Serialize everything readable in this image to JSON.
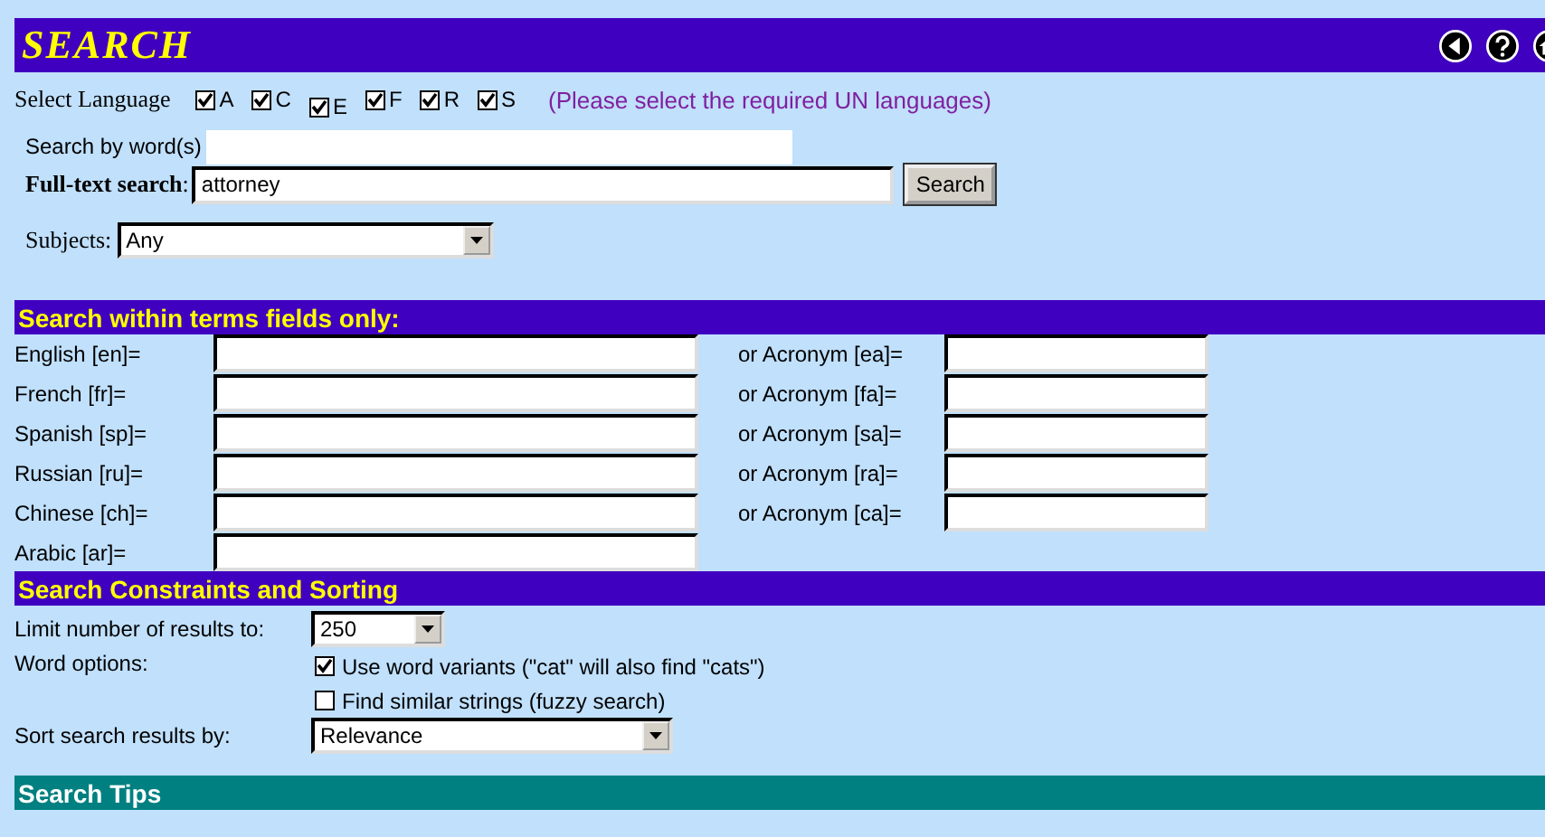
{
  "header": {
    "title": "SEARCH"
  },
  "language": {
    "label": "Select Language",
    "options": [
      {
        "label": "A",
        "checked": true
      },
      {
        "label": "C",
        "checked": true
      },
      {
        "label": "E",
        "checked": true
      },
      {
        "label": "F",
        "checked": true
      },
      {
        "label": "R",
        "checked": true
      },
      {
        "label": "S",
        "checked": true
      }
    ],
    "hint": "(Please select the required UN languages)"
  },
  "search_by_words": {
    "label": "Search by word(s)"
  },
  "full_text": {
    "label": "**Full-text search**:",
    "value": "attorney",
    "button": "Search"
  },
  "subjects": {
    "label": "Subjects:",
    "value": "Any"
  },
  "terms": {
    "title": "Search within terms fields only:",
    "rows": [
      {
        "label": "English [en]=",
        "acronym": "or Acronym [ea]="
      },
      {
        "label": "French [fr]=",
        "acronym": "or Acronym [fa]="
      },
      {
        "label": "Spanish [sp]=",
        "acronym": "or Acronym [sa]="
      },
      {
        "label": "Russian [ru]=",
        "acronym": "or Acronym [ra]="
      },
      {
        "label": "Chinese [ch]=",
        "acronym": "or Acronym [ca]="
      },
      {
        "label": "Arabic [ar]="
      }
    ]
  },
  "constraints": {
    "title": "Search Constraints and Sorting",
    "limit": {
      "label": "Limit number of results to:",
      "value": "250"
    },
    "word_options": {
      "label": "Word options:",
      "options": [
        {
          "label": "Use word variants (\"cat\" will also find \"cats\")",
          "checked": true
        },
        {
          "label": "Find similar strings (fuzzy search)",
          "checked": false
        }
      ]
    },
    "sort": {
      "label": "Sort search results by:",
      "value": "Relevance"
    }
  },
  "tips": {
    "title": "Search Tips"
  }
}
